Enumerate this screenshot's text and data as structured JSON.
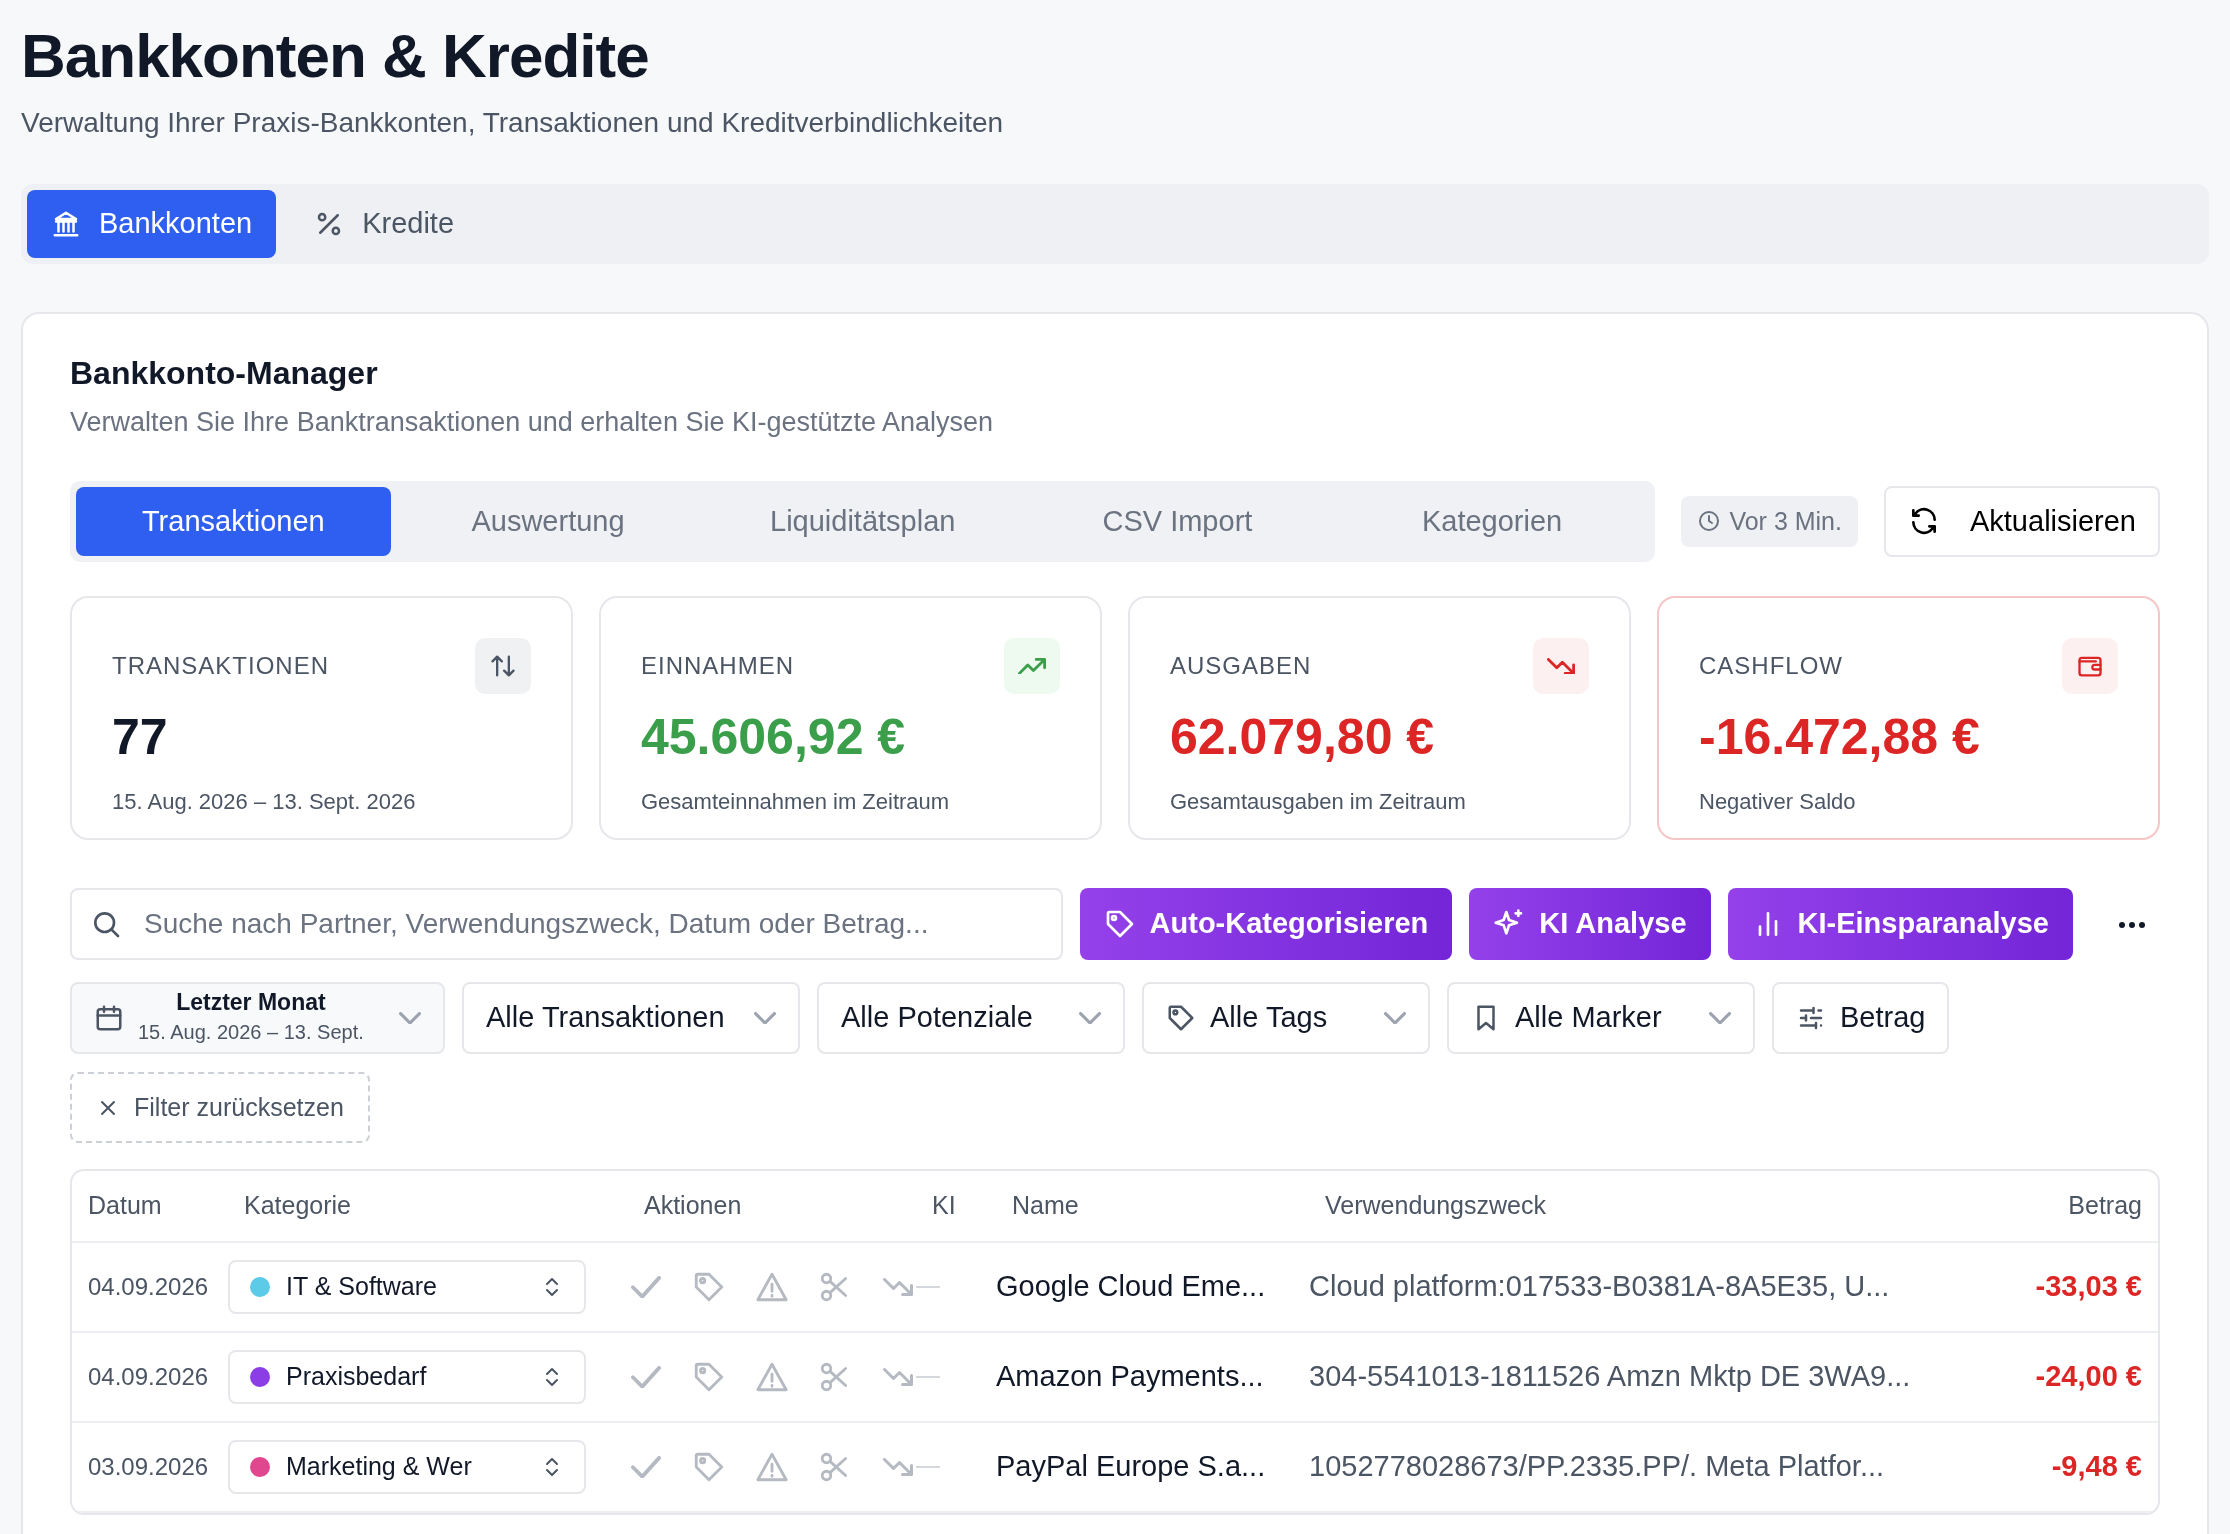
{
  "page": {
    "title": "Bankkonten & Kredite",
    "subtitle": "Verwaltung Ihrer Praxis-Bankkonten, Transaktionen und Kreditverbindlichkeiten"
  },
  "top_tabs": [
    {
      "kind": "bank",
      "label": "Bankkonten",
      "selected": true
    },
    {
      "kind": "percent",
      "label": "Kredite",
      "selected": false
    }
  ],
  "manager": {
    "title": "Bankkonto-Manager",
    "subtitle": "Verwalten Sie Ihre Banktransaktionen und erhalten Sie KI-gestützte Analysen"
  },
  "tabs": [
    {
      "label": "Transaktionen",
      "selected": true
    },
    {
      "label": "Auswertung",
      "selected": false
    },
    {
      "label": "Liquiditätsplan",
      "selected": false
    },
    {
      "label": "CSV Import",
      "selected": false
    },
    {
      "label": "Kategorien",
      "selected": false
    }
  ],
  "last_update": "Vor 3 Min.",
  "refresh_button": "Aktualisieren",
  "stats": [
    {
      "kind": "count",
      "label": "TRANSAKTIONEN",
      "value": "77",
      "note": "15. Aug. 2026 – 13. Sept. 2026"
    },
    {
      "kind": "income",
      "label": "EINNAHMEN",
      "value": "45.606,92 €",
      "note": "Gesamteinnahmen im Zeitraum"
    },
    {
      "kind": "expense",
      "label": "AUSGABEN",
      "value": "62.079,80 €",
      "note": "Gesamtausgaben im Zeitraum"
    },
    {
      "kind": "cashflow",
      "label": "CASHFLOW",
      "value": "-16.472,88 €",
      "note": "Negativer Saldo"
    }
  ],
  "search": {
    "placeholder": "Suche nach Partner, Verwendungszweck, Datum oder Betrag..."
  },
  "action_buttons": [
    {
      "kind": "tag",
      "label": "Auto-Kategorisieren"
    },
    {
      "kind": "sparkle",
      "label": "KI Analyse"
    },
    {
      "kind": "chart",
      "label": "KI-Einsparanalyse"
    }
  ],
  "filters": [
    {
      "kind": "date",
      "label": "Letzter Monat",
      "sublabel": "15. Aug. 2026 – 13. Sept."
    },
    {
      "kind": "select",
      "label": "Alle Transaktionen"
    },
    {
      "kind": "select",
      "label": "Alle Potenziale"
    },
    {
      "kind": "tags",
      "label": "Alle Tags"
    },
    {
      "kind": "marker",
      "label": "Alle Marker"
    },
    {
      "kind": "range",
      "label": "Betrag"
    }
  ],
  "reset_button": "Filter zurücksetzen",
  "table": {
    "columns": [
      "Datum",
      "Kategorie",
      "Aktionen",
      "KI",
      "Name",
      "Verwendungszweck",
      "Betrag"
    ],
    "rows": [
      {
        "date": "04.09.2026",
        "category": "IT & Software",
        "color": "#5bcbe8",
        "name": "Google Cloud Eme...",
        "purpose": "Cloud platform:017533-B0381A-8A5E35, U...",
        "amount": "-33,03 €"
      },
      {
        "date": "04.09.2026",
        "category": "Praxisbedarf",
        "color": "#8c3ee6",
        "name": "Amazon Payments...",
        "purpose": "304-5541013-1811526 Amzn Mktp DE 3WA9...",
        "amount": "-24,00 €"
      },
      {
        "date": "03.09.2026",
        "category": "Marketing & Wer",
        "color": "#e0478e",
        "name": "PayPal Europe S.a...",
        "purpose": "1052778028673/PP.2335.PP/. Meta Platfor...",
        "amount": "-9,48 €"
      }
    ]
  }
}
